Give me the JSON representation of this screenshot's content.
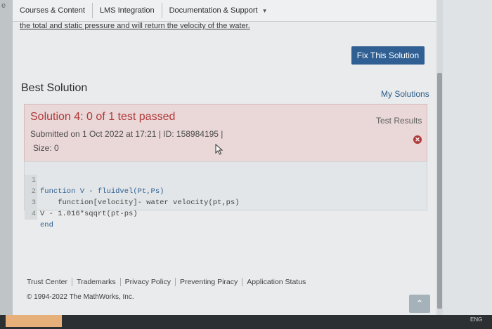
{
  "nav": {
    "items": [
      "Courses & Content",
      "LMS Integration",
      "Documentation & Support"
    ]
  },
  "problem": {
    "intro_text": "the total and static pressure and will return the velocity of the water."
  },
  "actions": {
    "fix_solution": "Fix This Solution",
    "my_solutions": "My Solutions"
  },
  "best": {
    "title": "Best Solution"
  },
  "solution": {
    "heading": "Solution 4: 0 of 1 test passed",
    "submitted": "Submitted on 1 Oct 2022 at 17:21  |  ID: 158984195  |",
    "size": "Size: 0",
    "test_results": "Test Results"
  },
  "code": {
    "lines": [
      {
        "num": "1",
        "text": "function V - fluidvel(Pt,Ps)"
      },
      {
        "num": "2",
        "text": "    function[velocity]- water velocity(pt,ps)"
      },
      {
        "num": "3",
        "text": "V - 1.016*sqqrt(pt-ps)"
      },
      {
        "num": "4",
        "text": "end"
      }
    ]
  },
  "footer": {
    "links": [
      "Trust Center",
      "Trademarks",
      "Privacy Policy",
      "Preventing Piracy",
      "Application Status"
    ],
    "copyright": "© 1994-2022 The MathWorks, Inc."
  },
  "colors": {
    "accent": "#2f5f93",
    "fail": "#b03a3a",
    "card_bg": "#ead7d7"
  },
  "taskbar": {
    "lang": "ENG"
  }
}
